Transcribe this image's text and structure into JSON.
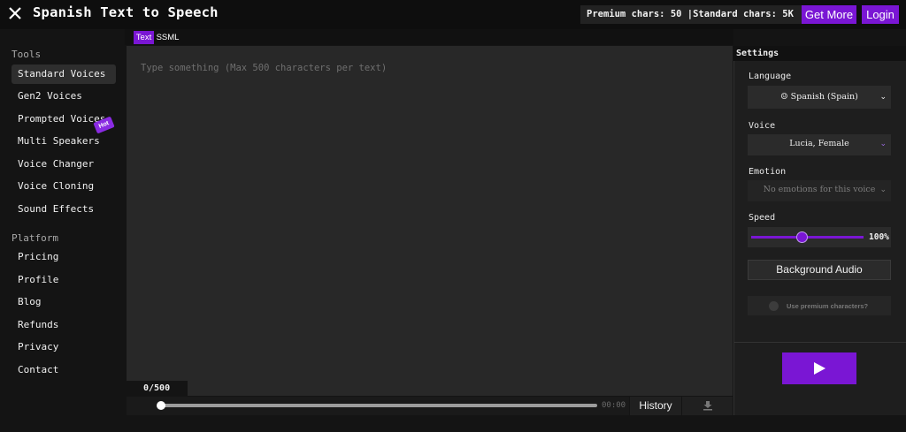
{
  "header": {
    "close_icon": "close-icon",
    "title": "Spanish Text to Speech",
    "chars_info": "Premium chars: 50 |Standard chars: 5K",
    "get_more_label": "Get More",
    "login_label": "Login",
    "accent_color": "#7a16d4"
  },
  "sidebar": {
    "tools_label": "Tools",
    "tools": [
      {
        "label": "Standard Voices",
        "active": true
      },
      {
        "label": "Gen2 Voices"
      },
      {
        "label": "Prompted Voices",
        "badge": "Hot"
      },
      {
        "label": "Multi Speakers"
      },
      {
        "label": "Voice Changer"
      },
      {
        "label": "Voice Cloning"
      },
      {
        "label": "Sound Effects"
      }
    ],
    "platform_label": "Platform",
    "platform": [
      {
        "label": "Pricing"
      },
      {
        "label": "Profile"
      },
      {
        "label": "Blog"
      },
      {
        "label": "Refunds"
      },
      {
        "label": "Privacy"
      },
      {
        "label": "Contact"
      }
    ]
  },
  "tabs": [
    {
      "label": "Text",
      "active": true
    },
    {
      "label": "SSML"
    }
  ],
  "editor": {
    "placeholder": "Type something (Max 500 characters per text)",
    "value": "",
    "counter": "0/500"
  },
  "player": {
    "time": "00:00",
    "history_label": "History",
    "download_icon": "download-icon"
  },
  "settings": {
    "title": "Settings",
    "language_label": "Language",
    "language_value": "☺ Spanish (Spain)",
    "voice_label": "Voice",
    "voice_value": "Lucia, Female",
    "emotion_label": "Emotion",
    "emotion_value": "No emotions for this voice",
    "speed_label": "Speed",
    "speed_value": "100%",
    "speed_fraction": 0.45,
    "background_audio_label": "Background Audio",
    "premium_label": "Use premium characters?",
    "play_icon": "play-icon"
  }
}
